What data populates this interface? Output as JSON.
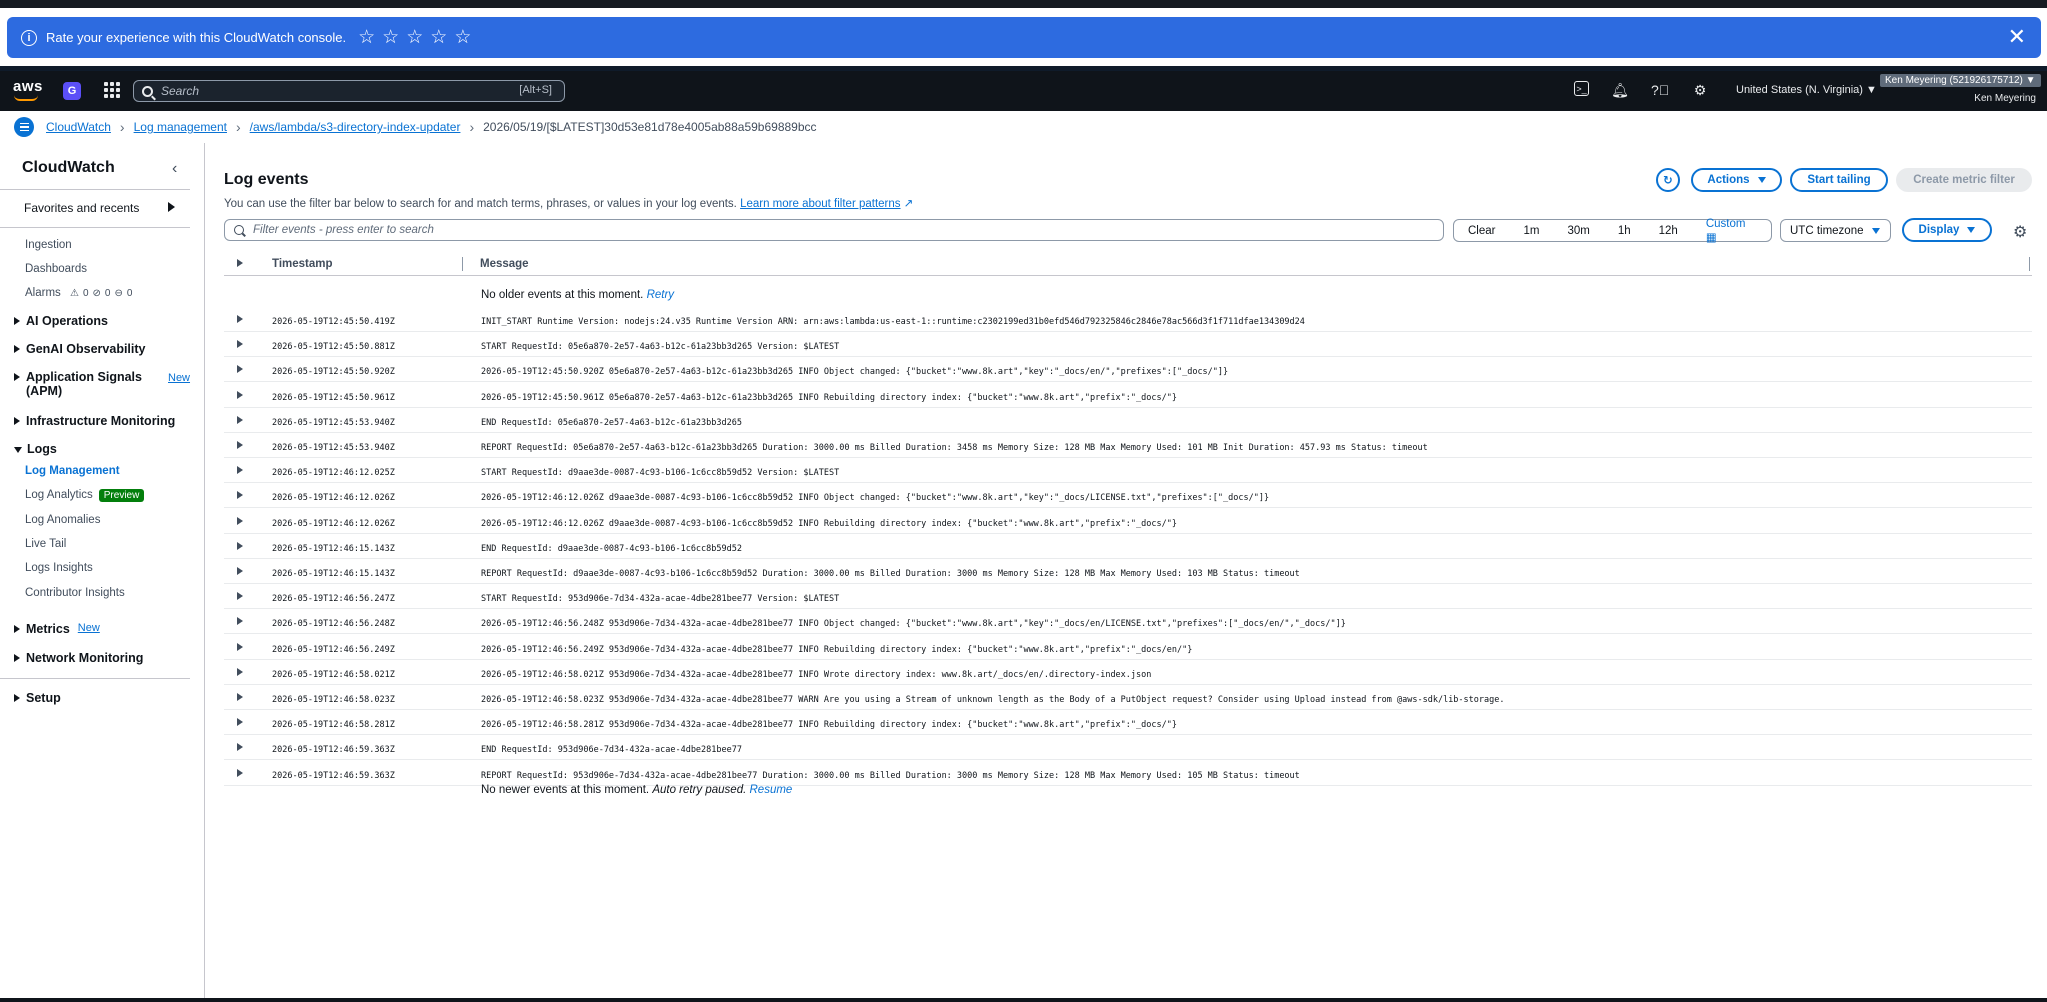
{
  "banner": {
    "text": "Rate your experience with this CloudWatch console.",
    "stars": [
      "☆",
      "☆",
      "☆",
      "☆",
      "☆"
    ],
    "close": "✕"
  },
  "nav": {
    "logo": "aws",
    "search_placeholder": "Search",
    "search_shortcut": "[Alt+S]",
    "region": "United States (N. Virginia) ▼",
    "account": "Ken Meyering (521926175712) ▼",
    "user": "Ken Meyering"
  },
  "breadcrumb": {
    "items": [
      "CloudWatch",
      "Log management",
      "/aws/lambda/s3-directory-index-updater"
    ],
    "current": "2026/05/19/[$LATEST]30d53e81d78e4005ab88a59b69889bcc"
  },
  "sidebar": {
    "title": "CloudWatch",
    "favorites": "Favorites and recents",
    "ingestion": "Ingestion",
    "dashboards": "Dashboards",
    "alarms": "Alarms",
    "alarm_counts": [
      "0",
      "0",
      "0"
    ],
    "ai_operations": "AI Operations",
    "genai": "GenAI Observability",
    "app_signals": "Application Signals (APM)",
    "new_label": "New",
    "infra": "Infrastructure Monitoring",
    "logs": "Logs",
    "log_items": [
      "Log Management",
      "Log Analytics",
      "Log Anomalies",
      "Live Tail",
      "Logs Insights",
      "Contributor Insights"
    ],
    "preview": "Preview",
    "metrics": "Metrics",
    "network": "Network Monitoring",
    "setup": "Setup"
  },
  "main": {
    "title": "Log events",
    "desc": "You can use the filter bar below to search for and match terms, phrases, or values in your log events.",
    "learn_more": "Learn more about filter patterns",
    "actions": "Actions",
    "start_tailing": "Start tailing",
    "create_metric_filter": "Create metric filter",
    "filter_placeholder": "Filter events - press enter to search",
    "ranges": [
      "Clear",
      "1m",
      "30m",
      "1h",
      "12h",
      "Custom"
    ],
    "timezone": "UTC timezone",
    "display": "Display",
    "col_timestamp": "Timestamp",
    "col_message": "Message",
    "older_text": "No older events at this moment.",
    "retry": "Retry",
    "newer_text": "No newer events at this moment.",
    "auto_retry": "Auto retry paused.",
    "resume": "Resume"
  },
  "rows": [
    {
      "ts": "2026-05-19T12:45:50.419Z",
      "msg": "INIT_START Runtime Version: nodejs:24.v35 Runtime Version ARN: arn:aws:lambda:us-east-1::runtime:c2302199ed31b0efd546d792325846c2846e78ac566d3f1f711dfae134309d24"
    },
    {
      "ts": "2026-05-19T12:45:50.881Z",
      "msg": "START RequestId: 05e6a870-2e57-4a63-b12c-61a23bb3d265 Version: $LATEST"
    },
    {
      "ts": "2026-05-19T12:45:50.920Z",
      "msg": "2026-05-19T12:45:50.920Z 05e6a870-2e57-4a63-b12c-61a23bb3d265 INFO Object changed: {\"bucket\":\"www.8k.art\",\"key\":\"_docs/en/\",\"prefixes\":[\"_docs/\"]}"
    },
    {
      "ts": "2026-05-19T12:45:50.961Z",
      "msg": "2026-05-19T12:45:50.961Z 05e6a870-2e57-4a63-b12c-61a23bb3d265 INFO Rebuilding directory index: {\"bucket\":\"www.8k.art\",\"prefix\":\"_docs/\"}"
    },
    {
      "ts": "2026-05-19T12:45:53.940Z",
      "msg": "END RequestId: 05e6a870-2e57-4a63-b12c-61a23bb3d265"
    },
    {
      "ts": "2026-05-19T12:45:53.940Z",
      "msg": "REPORT RequestId: 05e6a870-2e57-4a63-b12c-61a23bb3d265 Duration: 3000.00 ms Billed Duration: 3458 ms Memory Size: 128 MB Max Memory Used: 101 MB Init Duration: 457.93 ms Status: timeout"
    },
    {
      "ts": "2026-05-19T12:46:12.025Z",
      "msg": "START RequestId: d9aae3de-0087-4c93-b106-1c6cc8b59d52 Version: $LATEST"
    },
    {
      "ts": "2026-05-19T12:46:12.026Z",
      "msg": "2026-05-19T12:46:12.026Z d9aae3de-0087-4c93-b106-1c6cc8b59d52 INFO Object changed: {\"bucket\":\"www.8k.art\",\"key\":\"_docs/LICENSE.txt\",\"prefixes\":[\"_docs/\"]}"
    },
    {
      "ts": "2026-05-19T12:46:12.026Z",
      "msg": "2026-05-19T12:46:12.026Z d9aae3de-0087-4c93-b106-1c6cc8b59d52 INFO Rebuilding directory index: {\"bucket\":\"www.8k.art\",\"prefix\":\"_docs/\"}"
    },
    {
      "ts": "2026-05-19T12:46:15.143Z",
      "msg": "END RequestId: d9aae3de-0087-4c93-b106-1c6cc8b59d52"
    },
    {
      "ts": "2026-05-19T12:46:15.143Z",
      "msg": "REPORT RequestId: d9aae3de-0087-4c93-b106-1c6cc8b59d52 Duration: 3000.00 ms Billed Duration: 3000 ms Memory Size: 128 MB Max Memory Used: 103 MB Status: timeout"
    },
    {
      "ts": "2026-05-19T12:46:56.247Z",
      "msg": "START RequestId: 953d906e-7d34-432a-acae-4dbe281bee77 Version: $LATEST"
    },
    {
      "ts": "2026-05-19T12:46:56.248Z",
      "msg": "2026-05-19T12:46:56.248Z 953d906e-7d34-432a-acae-4dbe281bee77 INFO Object changed: {\"bucket\":\"www.8k.art\",\"key\":\"_docs/en/LICENSE.txt\",\"prefixes\":[\"_docs/en/\",\"_docs/\"]}"
    },
    {
      "ts": "2026-05-19T12:46:56.249Z",
      "msg": "2026-05-19T12:46:56.249Z 953d906e-7d34-432a-acae-4dbe281bee77 INFO Rebuilding directory index: {\"bucket\":\"www.8k.art\",\"prefix\":\"_docs/en/\"}"
    },
    {
      "ts": "2026-05-19T12:46:58.021Z",
      "msg": "2026-05-19T12:46:58.021Z 953d906e-7d34-432a-acae-4dbe281bee77 INFO Wrote directory index: www.8k.art/_docs/en/.directory-index.json"
    },
    {
      "ts": "2026-05-19T12:46:58.023Z",
      "msg": "2026-05-19T12:46:58.023Z 953d906e-7d34-432a-acae-4dbe281bee77 WARN Are you using a Stream of unknown length as the Body of a PutObject request? Consider using Upload instead from @aws-sdk/lib-storage."
    },
    {
      "ts": "2026-05-19T12:46:58.281Z",
      "msg": "2026-05-19T12:46:58.281Z 953d906e-7d34-432a-acae-4dbe281bee77 INFO Rebuilding directory index: {\"bucket\":\"www.8k.art\",\"prefix\":\"_docs/\"}"
    },
    {
      "ts": "2026-05-19T12:46:59.363Z",
      "msg": "END RequestId: 953d906e-7d34-432a-acae-4dbe281bee77"
    },
    {
      "ts": "2026-05-19T12:46:59.363Z",
      "msg": "REPORT RequestId: 953d906e-7d34-432a-acae-4dbe281bee77 Duration: 3000.00 ms Billed Duration: 3000 ms Memory Size: 128 MB Max Memory Used: 105 MB Status: timeout"
    }
  ],
  "colors": {
    "banner": "#2d6be0",
    "nav_bg": "#0f141a",
    "link": "#0972d3",
    "preview_badge": "#037f0c"
  }
}
